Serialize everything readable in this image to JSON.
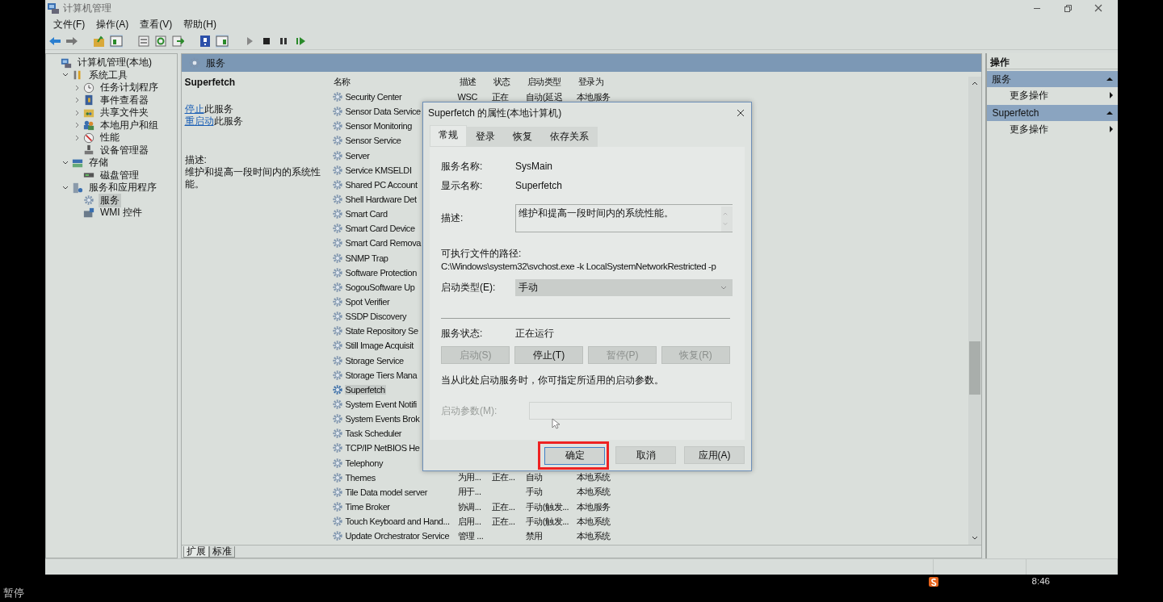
{
  "window": {
    "title": "计算机管理"
  },
  "menu": [
    "文件(F)",
    "操作(A)",
    "查看(V)",
    "帮助(H)"
  ],
  "tree": [
    {
      "label": "计算机管理(本地)",
      "selected": false,
      "children": [
        {
          "label": "系统工具",
          "selected": false,
          "expanded": true,
          "children": [
            {
              "label": "任务计划程序",
              "selected": false,
              "expanded": false
            },
            {
              "label": "事件查看器",
              "selected": false,
              "expanded": false
            },
            {
              "label": "共享文件夹",
              "selected": false,
              "expanded": false
            },
            {
              "label": "本地用户和组",
              "selected": false,
              "expanded": false
            },
            {
              "label": "性能",
              "selected": false,
              "expanded": false
            },
            {
              "label": "设备管理器",
              "selected": false
            }
          ]
        },
        {
          "label": "存储",
          "selected": false,
          "expanded": true,
          "children": [
            {
              "label": "磁盘管理",
              "selected": false
            }
          ]
        },
        {
          "label": "服务和应用程序",
          "selected": false,
          "expanded": true,
          "children": [
            {
              "label": "服务",
              "selected": true
            },
            {
              "label": "WMI 控件",
              "selected": false
            }
          ]
        }
      ]
    }
  ],
  "panel_title": "服务",
  "detail": {
    "title": "Superfetch",
    "actions": [
      {
        "link": "停止",
        "text": "此服务"
      },
      {
        "link": "重启动",
        "text": "此服务"
      }
    ],
    "description_label": "描述:",
    "description": "维护和提高一段时间内的系统性能。"
  },
  "table": {
    "columns": [
      "名称",
      "描述",
      "状态",
      "启动类型",
      "登录为"
    ],
    "rows": [
      {
        "name": "Security Center",
        "description": "WSC",
        "status": "正在",
        "startup": "自动(延迟",
        "logon": "本地服务",
        "selected": false
      },
      {
        "name": "Sensor Data Service",
        "selected": false
      },
      {
        "name": "Sensor Monitoring",
        "selected": false
      },
      {
        "name": "Sensor Service",
        "selected": false
      },
      {
        "name": "Server",
        "selected": false
      },
      {
        "name": "Service KMSELDI",
        "selected": false
      },
      {
        "name": "Shared PC Account",
        "selected": false
      },
      {
        "name": "Shell Hardware Det",
        "selected": false
      },
      {
        "name": "Smart Card",
        "selected": false
      },
      {
        "name": "Smart Card Device",
        "selected": false
      },
      {
        "name": "Smart Card Remova",
        "selected": false
      },
      {
        "name": "SNMP Trap",
        "selected": false
      },
      {
        "name": "Software Protection",
        "selected": false
      },
      {
        "name": "SogouSoftware Up",
        "selected": false
      },
      {
        "name": "Spot Verifier",
        "selected": false
      },
      {
        "name": "SSDP Discovery",
        "selected": false
      },
      {
        "name": "State Repository Se",
        "selected": false
      },
      {
        "name": "Still Image Acquisit",
        "selected": false
      },
      {
        "name": "Storage Service",
        "selected": false
      },
      {
        "name": "Storage Tiers Mana",
        "selected": false
      },
      {
        "name": "Superfetch",
        "selected": true
      },
      {
        "name": "System Event Notifi",
        "selected": false
      },
      {
        "name": "System Events Brok",
        "selected": false
      },
      {
        "name": "Task Scheduler",
        "selected": false
      },
      {
        "name": "TCP/IP NetBIOS He",
        "selected": false
      },
      {
        "name": "Telephony",
        "selected": false
      },
      {
        "name": "Themes",
        "description": "为用...",
        "status": "正在...",
        "startup": "自动",
        "logon": "本地系统",
        "selected": false
      },
      {
        "name": "Tile Data model server",
        "description": "用于...",
        "startup": "手动",
        "logon": "本地系统",
        "selected": false
      },
      {
        "name": "Time Broker",
        "description": "协调...",
        "status": "正在...",
        "startup": "手动(触发...",
        "logon": "本地服务",
        "selected": false
      },
      {
        "name": "Touch Keyboard and Hand...",
        "description": "启用...",
        "status": "正在...",
        "startup": "手动(触发...",
        "logon": "本地系统",
        "selected": false
      },
      {
        "name": "Update Orchestrator Service",
        "description": "管理 ...",
        "startup": "禁用",
        "logon": "本地系统",
        "selected": false
      }
    ]
  },
  "view_tabs": [
    {
      "label": "扩展",
      "selected": true
    },
    {
      "label": "标准",
      "selected": false
    }
  ],
  "actions_pane": {
    "title": "操作",
    "sections": [
      {
        "title": "服务",
        "items": [
          "更多操作"
        ]
      },
      {
        "title": "Superfetch",
        "items": [
          "更多操作"
        ]
      }
    ]
  },
  "dialog": {
    "title": "Superfetch 的属性(本地计算机)",
    "tabs": [
      {
        "label": "常规",
        "selected": true
      },
      {
        "label": "登录",
        "selected": false
      },
      {
        "label": "恢复",
        "selected": false
      },
      {
        "label": "依存关系",
        "selected": false
      }
    ],
    "service_name": {
      "label": "服务名称:",
      "value": "SysMain"
    },
    "display_name": {
      "label": "显示名称:",
      "value": "Superfetch"
    },
    "description": {
      "label": "描述:",
      "value": "维护和提高一段时间内的系统性能。"
    },
    "path": {
      "label": "可执行文件的路径:",
      "value": "C:\\Windows\\system32\\svchost.exe -k LocalSystemNetworkRestricted -p"
    },
    "startup_type": {
      "label": "启动类型(E):",
      "value": "手动"
    },
    "service_status": {
      "label": "服务状态:",
      "value": "正在运行"
    },
    "service_buttons": [
      {
        "label": "启动(S)",
        "disabled": true
      },
      {
        "label": "停止(T)",
        "disabled": false
      },
      {
        "label": "暂停(P)",
        "disabled": true
      },
      {
        "label": "恢复(R)",
        "disabled": true
      }
    ],
    "hint": "当从此处启动服务时，你可指定所适用的启动参数。",
    "parameters": {
      "label": "启动参数(M):",
      "disabled": true
    },
    "buttons": [
      {
        "label": "确定",
        "focused": true,
        "highlighted": true
      },
      {
        "label": "取消",
        "focused": false,
        "highlighted": false
      },
      {
        "label": "应用(A)",
        "focused": false,
        "highlighted": false
      }
    ]
  },
  "taskbar": {
    "time": "8:46"
  },
  "player": {
    "status": "暂停"
  }
}
